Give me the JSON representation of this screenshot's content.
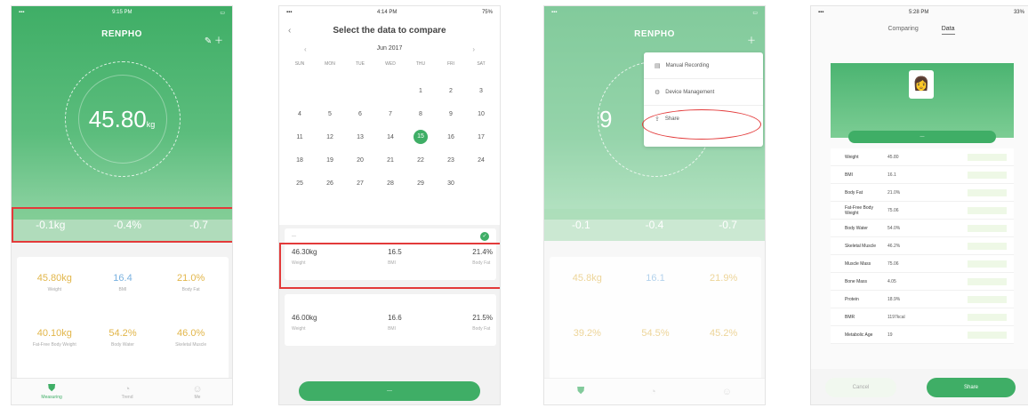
{
  "brand": {
    "primary": "#3fae66",
    "highlight": "#e33a3a"
  },
  "home": {
    "status": {
      "time": "9:15 PM"
    },
    "title": "RENPHO",
    "weight": {
      "value": "45.80",
      "unit": "kg"
    },
    "stats": [
      {
        "value": "-0.1",
        "unit": "kg"
      },
      {
        "value": "-0.4",
        "unit": "%"
      },
      {
        "value": "-0.7",
        "unit": ""
      }
    ],
    "metrics": [
      {
        "value": "45.80",
        "unit": "kg",
        "label": "Weight"
      },
      {
        "value": "16.4",
        "unit": "",
        "label": "BMI"
      },
      {
        "value": "21.0",
        "unit": "%",
        "label": "Body Fat"
      },
      {
        "value": "40.10",
        "unit": "kg",
        "label": "Fat-Free Body Weight"
      },
      {
        "value": "54.2",
        "unit": "%",
        "label": "Body Water"
      },
      {
        "value": "46.0",
        "unit": "%",
        "label": "Skeletal Muscle"
      }
    ],
    "tabs": [
      {
        "label": "Measuring",
        "icon": "shield-icon"
      },
      {
        "label": "Trend",
        "icon": "trend-icon"
      },
      {
        "label": "Me",
        "icon": "person-icon"
      }
    ]
  },
  "compare": {
    "status": {
      "time": "4:14 PM",
      "battery": "75%"
    },
    "title": "Select the data to compare",
    "month": "Jun 2017",
    "weekdays": [
      "SUN",
      "MON",
      "TUE",
      "WED",
      "THU",
      "FRI",
      "SAT"
    ],
    "days": [
      "",
      "",
      "",
      "",
      "1",
      "2",
      "3",
      "4",
      "5",
      "6",
      "7",
      "8",
      "9",
      "10",
      "11",
      "12",
      "13",
      "14",
      "15",
      "16",
      "17",
      "18",
      "19",
      "20",
      "21",
      "22",
      "23",
      "24",
      "25",
      "26",
      "27",
      "28",
      "29",
      "30",
      ""
    ],
    "selected_day": "15",
    "records": [
      {
        "values": [
          {
            "v": "46.30",
            "u": "kg",
            "l": "Weight"
          },
          {
            "v": "16.5",
            "u": "",
            "l": "BMI"
          },
          {
            "v": "21.4",
            "u": "%",
            "l": "Body Fat"
          }
        ]
      },
      {
        "values": [
          {
            "v": "46.00",
            "u": "kg",
            "l": "Weight"
          },
          {
            "v": "16.6",
            "u": "",
            "l": "BMI"
          },
          {
            "v": "21.5",
            "u": "%",
            "l": "Body Fat"
          }
        ]
      }
    ]
  },
  "menu_screen": {
    "title": "RENPHO",
    "weight_prefix": "9",
    "stats": [
      "-0.1",
      "-0.4",
      "-0.7"
    ],
    "metrics": [
      {
        "value": "45.8",
        "unit": "kg"
      },
      {
        "value": "16.1",
        "unit": ""
      },
      {
        "value": "21.9",
        "unit": "%"
      },
      {
        "value": "39.2",
        "unit": "%"
      },
      {
        "value": "54.5",
        "unit": "%"
      },
      {
        "value": "45.2",
        "unit": "%"
      }
    ],
    "menu": [
      {
        "label": "Manual Recording",
        "icon": "edit-icon"
      },
      {
        "label": "Device Management",
        "icon": "device-icon"
      },
      {
        "label": "Share",
        "icon": "share-icon"
      }
    ]
  },
  "share": {
    "status": {
      "time": "5:28 PM",
      "battery": "33%"
    },
    "tabs": [
      "Comparing",
      "Data"
    ],
    "rows": [
      {
        "name": "Weight",
        "value": "45.80"
      },
      {
        "name": "BMI",
        "value": "16.1"
      },
      {
        "name": "Body Fat",
        "value": "21.0%"
      },
      {
        "name": "Fat-Free Body Weight",
        "value": "75.06"
      },
      {
        "name": "Body Water",
        "value": "54.0%"
      },
      {
        "name": "Skeletal Muscle",
        "value": "46.2%"
      },
      {
        "name": "Muscle Mass",
        "value": "75.06"
      },
      {
        "name": "Bone Mass",
        "value": "4.05"
      },
      {
        "name": "Protein",
        "value": "18.9%"
      },
      {
        "name": "BMR",
        "value": "1197kcal"
      },
      {
        "name": "Metabolic Age",
        "value": "19"
      }
    ],
    "buttons": {
      "cancel": "Cancel",
      "share": "Share"
    }
  }
}
